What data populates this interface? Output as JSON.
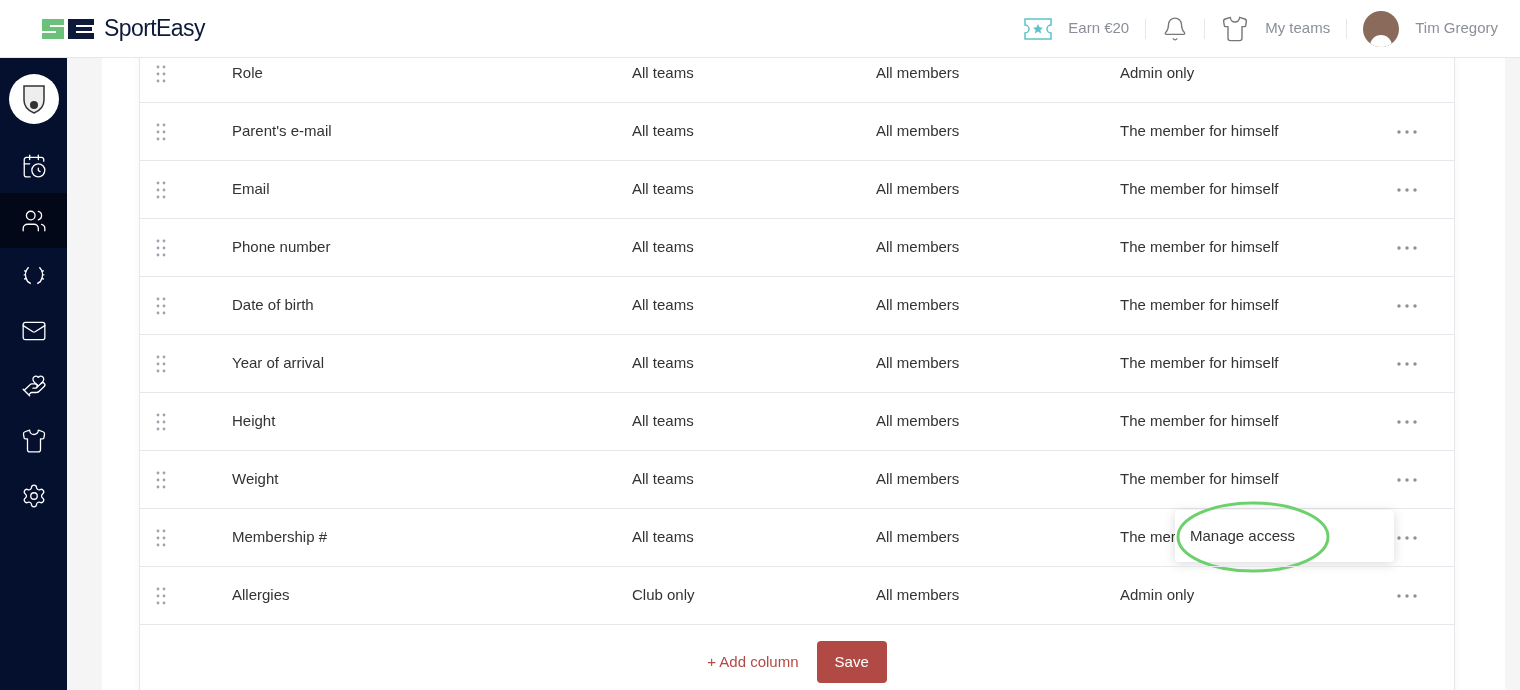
{
  "header": {
    "brand": "SportEasy",
    "earn": "Earn €20",
    "my_teams": "My teams",
    "user": "Tim Gregory"
  },
  "sidebar": {
    "items": [
      {
        "kind": "calendar",
        "selected": false
      },
      {
        "kind": "members",
        "selected": true
      },
      {
        "kind": "trophies",
        "selected": false
      },
      {
        "kind": "mail",
        "selected": false
      },
      {
        "kind": "volunteer",
        "selected": false
      },
      {
        "kind": "shirt",
        "selected": false
      },
      {
        "kind": "settings",
        "selected": false
      }
    ]
  },
  "table": {
    "rows": [
      {
        "name": "Role",
        "teams": "All teams",
        "members": "All members",
        "access": "Admin only",
        "menu": false
      },
      {
        "name": "Parent's e-mail",
        "teams": "All teams",
        "members": "All members",
        "access": "The member for himself",
        "menu": true
      },
      {
        "name": "Email",
        "teams": "All teams",
        "members": "All members",
        "access": "The member for himself",
        "menu": true
      },
      {
        "name": "Phone number",
        "teams": "All teams",
        "members": "All members",
        "access": "The member for himself",
        "menu": true
      },
      {
        "name": "Date of birth",
        "teams": "All teams",
        "members": "All members",
        "access": "The member for himself",
        "menu": true
      },
      {
        "name": "Year of arrival",
        "teams": "All teams",
        "members": "All members",
        "access": "The member for himself",
        "menu": true
      },
      {
        "name": "Height",
        "teams": "All teams",
        "members": "All members",
        "access": "The member for himself",
        "menu": true
      },
      {
        "name": "Weight",
        "teams": "All teams",
        "members": "All members",
        "access": "The member for himself",
        "menu": true
      },
      {
        "name": "Membership #",
        "teams": "All teams",
        "members": "All members",
        "access": "The mer",
        "menu": true,
        "popup": "Manage access"
      },
      {
        "name": "Allergies",
        "teams": "Club only",
        "members": "All members",
        "access": "Admin only",
        "menu": true
      }
    ]
  },
  "footer": {
    "add_column": "+ Add column",
    "save": "Save"
  }
}
